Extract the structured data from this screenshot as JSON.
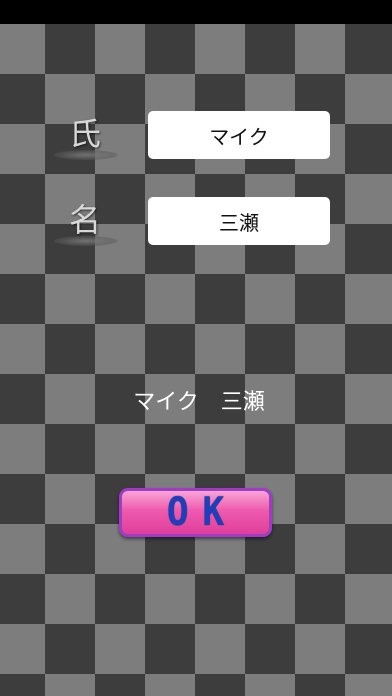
{
  "labels": {
    "family_name": "氏",
    "given_name": "名"
  },
  "fields": {
    "family_name_value": "マイク",
    "given_name_value": "三瀬"
  },
  "display": {
    "full_name": "マイク　三瀬"
  },
  "buttons": {
    "ok_label": "OK"
  },
  "colors": {
    "checker_light": "#7d7d7d",
    "checker_dark": "#3d3d3d",
    "ok_button_pink": "#ee5aae",
    "ok_button_border": "#a03ac8",
    "ok_text_blue": "#1f3fb8"
  }
}
